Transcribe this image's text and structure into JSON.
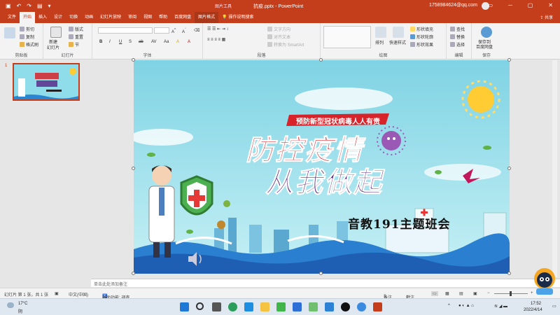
{
  "titlebar": {
    "context_label": "图片工具",
    "doc_title": "抗疫.pptx  -  PowerPoint",
    "account": "1758984624@qq.com",
    "win_buttons": [
      "▭",
      "─",
      "▢",
      "✕"
    ]
  },
  "tabs": [
    {
      "label": "文件"
    },
    {
      "label": "开始"
    },
    {
      "label": "插入"
    },
    {
      "label": "设计"
    },
    {
      "label": "切换"
    },
    {
      "label": "动画"
    },
    {
      "label": "幻灯片放映"
    },
    {
      "label": "审阅"
    },
    {
      "label": "视图"
    },
    {
      "label": "帮助"
    },
    {
      "label": "百度网盘"
    },
    {
      "label": "图片格式"
    },
    {
      "label": "操作说明搜索"
    }
  ],
  "share_label": "共享",
  "ribbon": {
    "clipboard": {
      "cut": "剪切",
      "copy": "复制",
      "format_painter": "格式刷",
      "group": "剪贴板"
    },
    "slides": {
      "new_slide": "新建",
      "new_slide2": "幻灯片",
      "layout": "版式",
      "reset": "重置",
      "section": "节",
      "group": "幻灯片"
    },
    "font": {
      "group": "字体",
      "buttons": [
        "B",
        "I",
        "U",
        "S",
        "ab",
        "AV",
        "Aa",
        "A",
        "A"
      ]
    },
    "paragraph": {
      "group": "段落",
      "text_dir": "文字方向",
      "align_text": "对齐文本",
      "smartart": "转换为 SmartArt"
    },
    "drawing": {
      "arrange": "排列",
      "quick_styles": "快速样式",
      "fill": "形状填充",
      "outline": "形状轮廓",
      "effects": "形状效果",
      "group": "绘图"
    },
    "editing": {
      "find": "查找",
      "replace": "替换",
      "select": "选择",
      "group": "编辑"
    },
    "save": {
      "line1": "保存到",
      "line2": "百度网盘",
      "group": "保存"
    }
  },
  "slide_pane": {
    "number": "1"
  },
  "slide": {
    "banner": "预防新型冠状病毒人人有责",
    "headline1": "防控疫情",
    "headline2": "从我做起",
    "class_label": "音教191主题班会"
  },
  "notes_placeholder": "单击此处添加备注",
  "status": {
    "slide_info": "幻灯片 第 1 张，共 1 张",
    "language": "中文(中国)",
    "accessibility": "辅助功能: 调查",
    "notes": "备注",
    "comments": "批注"
  },
  "taskbar": {
    "temp": "17°C",
    "weather": "阴",
    "time": "17:52",
    "date": "2022/4/14"
  },
  "colors": {
    "accent": "#c43e1c",
    "slide_bg": "#93dde9",
    "headline_red": "#d8232a",
    "headline_purple": "#5b2b8a"
  }
}
